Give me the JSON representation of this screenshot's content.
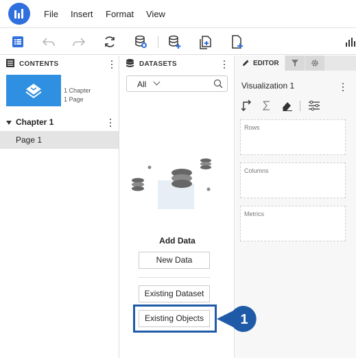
{
  "menu": {
    "items": [
      "File",
      "Insert",
      "Format",
      "View"
    ]
  },
  "contents": {
    "title": "CONTENTS",
    "thumbnail_meta": [
      "1 Chapter",
      "1 Page"
    ],
    "chapter": "Chapter 1",
    "page": "Page 1"
  },
  "datasets": {
    "title": "DATASETS",
    "filter_value": "All",
    "add_data_title": "Add Data",
    "buttons": {
      "new_data": "New Data",
      "existing_dataset": "Existing Dataset",
      "existing_objects": "Existing Objects"
    }
  },
  "editor": {
    "tab_label": "EDITOR",
    "visualization_title": "Visualization 1",
    "drop_zones": [
      "Rows",
      "Columns",
      "Metrics"
    ]
  },
  "callout": {
    "number": "1"
  },
  "colors": {
    "brand_blue": "#2f6fde",
    "highlight": "#1f5aa8",
    "callout": "#1f5aa8",
    "thumbnail": "#2f8fe0"
  },
  "icons": {
    "toolbar": [
      "toc-icon",
      "undo-icon",
      "redo-icon",
      "refresh-icon",
      "dataset-icon",
      "add-dataset-icon",
      "duplicate-page-icon",
      "new-page-icon",
      "visualization-gallery-icon"
    ]
  }
}
